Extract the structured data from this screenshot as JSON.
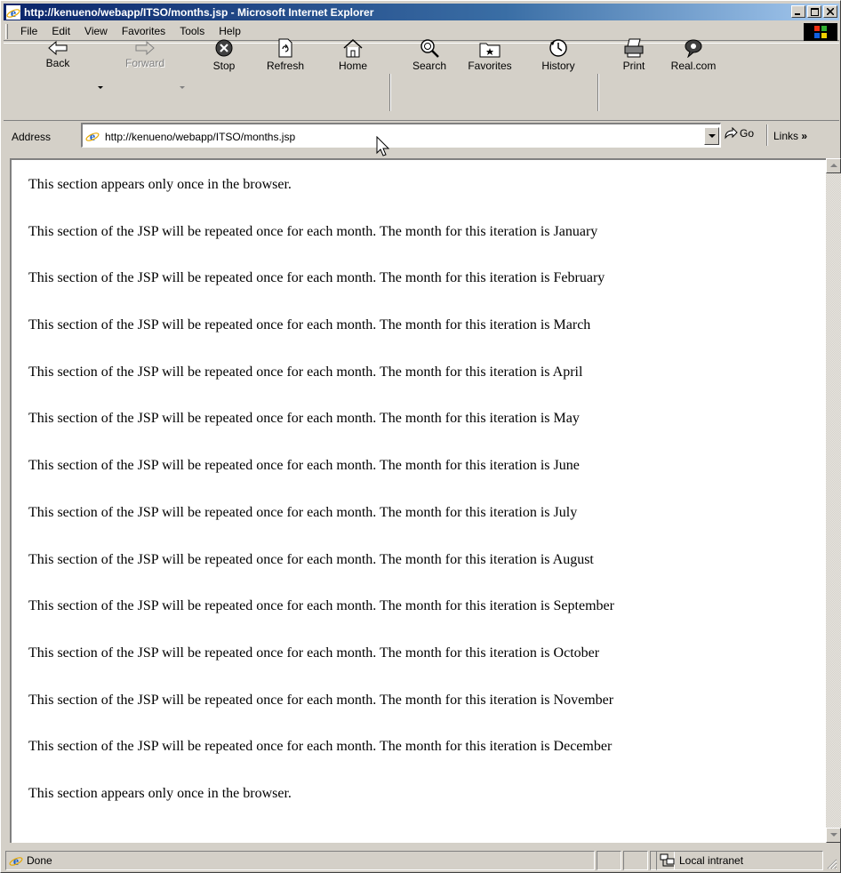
{
  "window": {
    "title": "http://kenueno/webapp/ITSO/months.jsp - Microsoft Internet Explorer",
    "buttons": {
      "minimize": "_",
      "maximize": "□",
      "close": "×"
    }
  },
  "menu": {
    "items": [
      {
        "label": "File"
      },
      {
        "label": "Edit"
      },
      {
        "label": "View"
      },
      {
        "label": "Favorites"
      },
      {
        "label": "Tools"
      },
      {
        "label": "Help"
      }
    ]
  },
  "toolbar": {
    "back": "Back",
    "forward": "Forward",
    "stop": "Stop",
    "refresh": "Refresh",
    "home": "Home",
    "search": "Search",
    "favorites": "Favorites",
    "history": "History",
    "print": "Print",
    "realcom": "Real.com"
  },
  "address": {
    "label": "Address",
    "url": "http://kenueno/webapp/ITSO/months.jsp",
    "go": "Go",
    "links": "Links"
  },
  "page": {
    "lines": [
      "This section appears only once in the browser.",
      "This section of the JSP will be repeated once for each month. The month for this iteration is January",
      "This section of the JSP will be repeated once for each month. The month for this iteration is February",
      "This section of the JSP will be repeated once for each month. The month for this iteration is March",
      "This section of the JSP will be repeated once for each month. The month for this iteration is April",
      "This section of the JSP will be repeated once for each month. The month for this iteration is May",
      "This section of the JSP will be repeated once for each month. The month for this iteration is June",
      "This section of the JSP will be repeated once for each month. The month for this iteration is July",
      "This section of the JSP will be repeated once for each month. The month for this iteration is August",
      "This section of the JSP will be repeated once for each month. The month for this iteration is September",
      "This section of the JSP will be repeated once for each month. The month for this iteration is October",
      "This section of the JSP will be repeated once for each month. The month for this iteration is November",
      "This section of the JSP will be repeated once for each month. The month for this iteration is December",
      "This section appears only once in the browser."
    ]
  },
  "status": {
    "text": "Done",
    "zone": "Local intranet"
  }
}
